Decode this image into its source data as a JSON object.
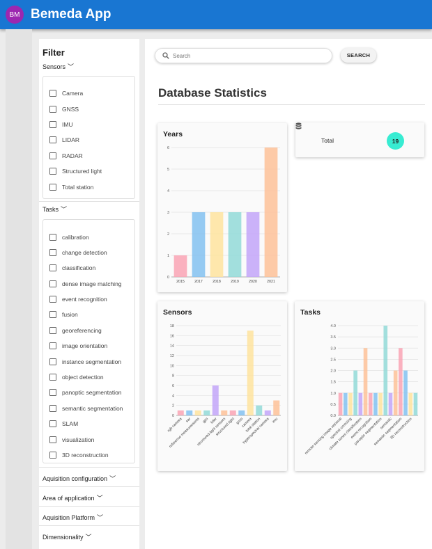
{
  "app": {
    "avatar": "BM",
    "title": "Bemeda App"
  },
  "sidebar": {
    "title": "Filter",
    "sensors": {
      "label": "Sensors",
      "items": [
        "Camera",
        "GNSS",
        "IMU",
        "LIDAR",
        "RADAR",
        "Structured light",
        "Total station"
      ]
    },
    "tasks": {
      "label": "Tasks",
      "items": [
        "calibration",
        "change detection",
        "classification",
        "dense image matching",
        "event recognition",
        "fusion",
        "georeferencing",
        "image orientation",
        "instance segmentation",
        "object detection",
        "panoptic segmentation",
        "semantic segmentation",
        "SLAM",
        "visualization",
        "3D reconstruction"
      ]
    },
    "collapsed": [
      "Aquisition configuration",
      "Area of application",
      "Aquisition Platform",
      "Dimensionality"
    ]
  },
  "search": {
    "placeholder": "Search",
    "button_label": "SEARCH"
  },
  "main": {
    "title": "Database Statistics"
  },
  "total": {
    "label": "Total",
    "value": "19",
    "icon": "database-icon"
  },
  "palette": [
    "#f9a3b4",
    "#83c1f0",
    "#fee39d",
    "#92d9d7",
    "#c2a4f8",
    "#fdc198",
    "#d6d8dc"
  ],
  "chart_data": [
    {
      "title": "Years",
      "type": "bar",
      "categories": [
        "2015",
        "2017",
        "2018",
        "2019",
        "2020",
        "2021"
      ],
      "values": [
        1,
        3,
        3,
        3,
        3,
        6
      ],
      "ylim": [
        0,
        6
      ],
      "yticks": [
        0,
        1,
        2,
        3,
        4,
        5,
        6
      ],
      "grid": true
    },
    {
      "title": "Sensors",
      "type": "bar",
      "categories": [
        "rgb camera",
        "sar",
        "reference measurements",
        "gps",
        "lidar",
        "structured-light sensors",
        "structured light",
        "gnss",
        "camera",
        "total station",
        "hyperspectral camera",
        "imu"
      ],
      "values": [
        1,
        1,
        1,
        1,
        6,
        1,
        1,
        1,
        17,
        2,
        1,
        3
      ],
      "ylim": [
        0,
        18
      ],
      "yticks": [
        0,
        2,
        4,
        6,
        8,
        10,
        12,
        14,
        16,
        18
      ],
      "grid": true
    },
    {
      "title": "Tasks",
      "type": "bar",
      "categories": [
        "remote sensing image retrieval",
        "",
        "spectral unmixing",
        "",
        "climate zones classification",
        "",
        "event recognition",
        "",
        "panoptic segmentation",
        "",
        "semantic",
        "",
        "semantic segmentation",
        "",
        "3D reconstruction",
        ""
      ],
      "values": [
        1,
        1,
        1,
        2,
        1,
        3,
        1,
        1,
        1,
        4,
        1,
        2,
        3,
        2,
        1,
        1
      ],
      "ylim": [
        0,
        4
      ],
      "yticks": [
        0.0,
        0.5,
        1.0,
        1.5,
        2.0,
        2.5,
        3.0,
        3.5,
        4.0
      ],
      "grid": true
    }
  ]
}
